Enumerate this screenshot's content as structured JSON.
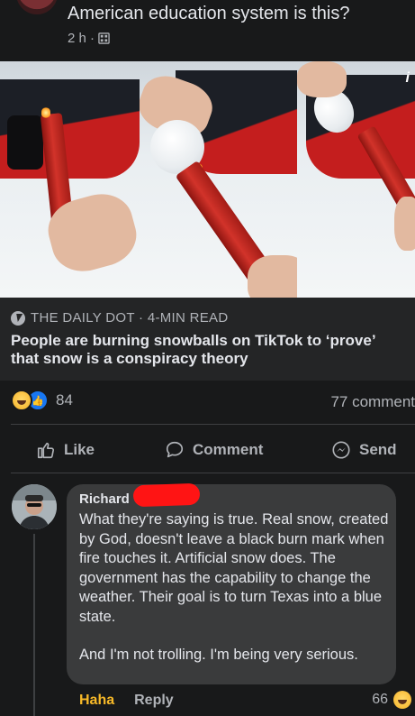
{
  "post": {
    "title": "American education system is this?",
    "meta": "2 h ·",
    "privacy_icon": "globe-icon"
  },
  "link": {
    "source": "THE DAILY DOT · 4-MIN READ",
    "headline": "People are burning snowballs on TikTok to ‘prove’ that snow is a conspiracy theory"
  },
  "stats": {
    "reaction_count": "84",
    "comment_count": "77 comment"
  },
  "actions": {
    "like": "Like",
    "comment": "Comment",
    "send": "Send"
  },
  "comment": {
    "author": "Richard",
    "paragraph1": "What they're saying is true. Real snow, created by God, doesn't leave a black burn mark when fire touches it. Artificial snow does. The government has the capability to change the weather. Their goal is to turn Texas into a blue state.",
    "paragraph2": "And I'm not trolling. I'm being very serious.",
    "haha_label": "Haha",
    "reply_label": "Reply",
    "reaction_count": "66"
  },
  "colors": {
    "background": "#18191a",
    "bubble": "#3a3b3c",
    "haha": "#f7b928",
    "like_blue": "#1877f2",
    "redaction": "#ff1414"
  }
}
